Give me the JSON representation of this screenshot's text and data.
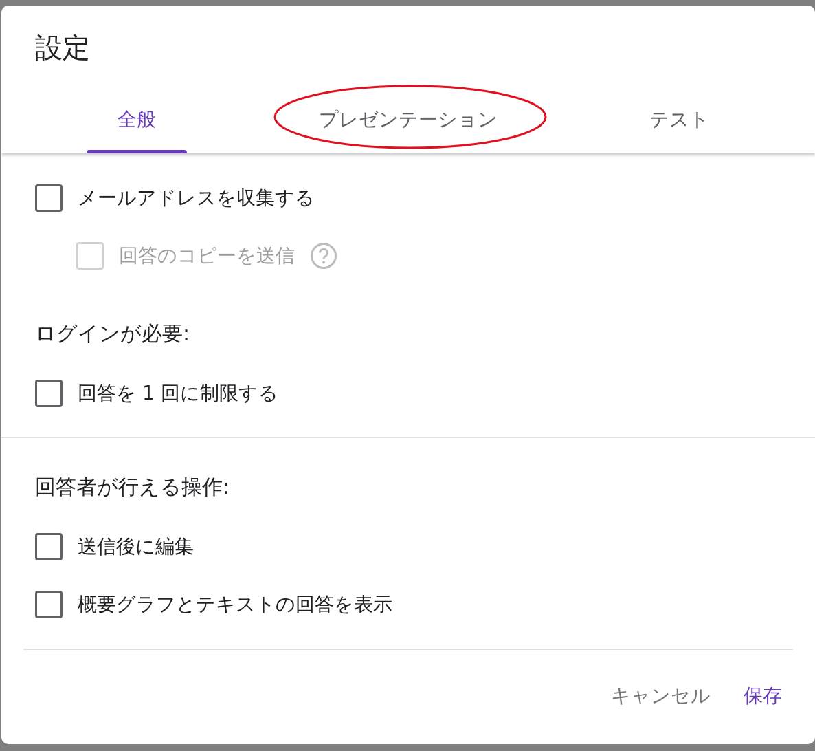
{
  "dialog": {
    "title": "設定"
  },
  "tabs": [
    {
      "label": "全般",
      "selected": true,
      "circled": false
    },
    {
      "label": "プレゼンテーション",
      "selected": false,
      "circled": true
    },
    {
      "label": "テスト",
      "selected": false,
      "circled": false
    }
  ],
  "sections": [
    {
      "rows": [
        {
          "kind": "checkbox",
          "label": "メールアドレスを収集する",
          "checked": false,
          "disabled": false,
          "help": false,
          "children": [
            {
              "kind": "checkbox",
              "label": "回答のコピーを送信",
              "checked": false,
              "disabled": true,
              "help": true
            }
          ]
        },
        {
          "kind": "heading",
          "label": "ログインが必要:"
        },
        {
          "kind": "checkbox",
          "label": "回答を 1 回に制限する",
          "checked": false,
          "disabled": false,
          "help": false
        }
      ]
    },
    {
      "rows": [
        {
          "kind": "heading",
          "label": "回答者が行える操作:"
        },
        {
          "kind": "checkbox",
          "label": "送信後に編集",
          "checked": false,
          "disabled": false,
          "help": false
        },
        {
          "kind": "checkbox",
          "label": "概要グラフとテキストの回答を表示",
          "checked": false,
          "disabled": false,
          "help": false
        }
      ]
    }
  ],
  "buttons": [
    {
      "label": "キャンセル",
      "kind": "secondary"
    },
    {
      "label": "保存",
      "kind": "primary"
    }
  ]
}
